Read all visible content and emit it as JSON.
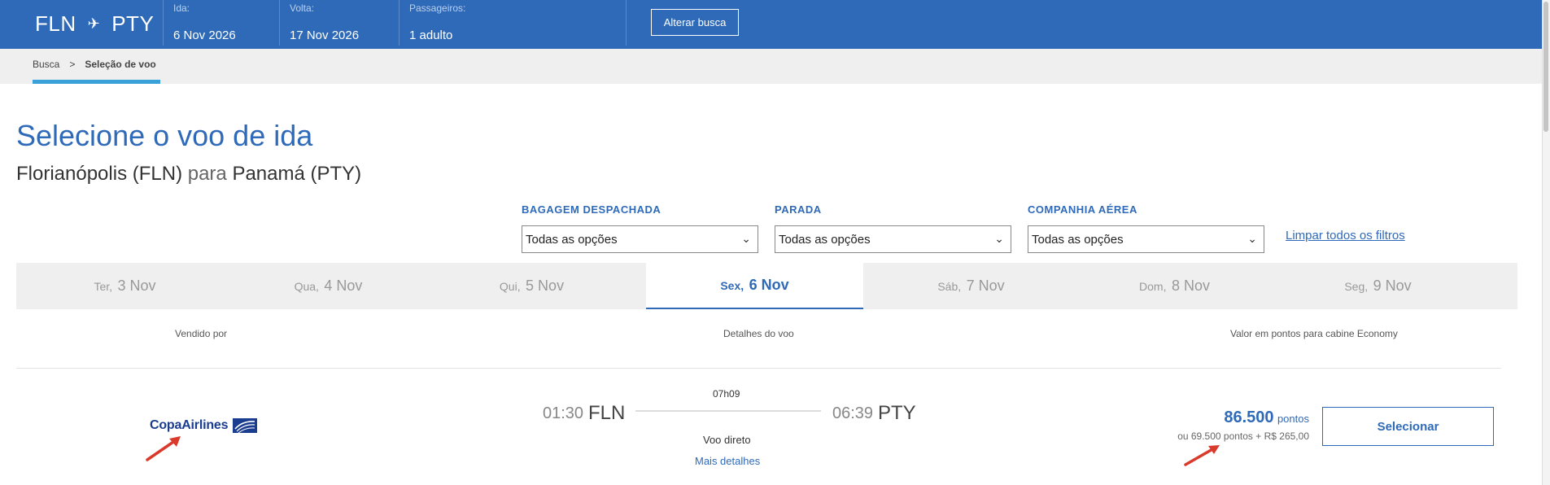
{
  "topbar": {
    "origin": "FLN",
    "destination": "PTY",
    "fields": [
      {
        "label": "Ida:",
        "value": "6 Nov 2026"
      },
      {
        "label": "Volta:",
        "value": "17 Nov 2026"
      },
      {
        "label": "Passageiros:",
        "value": "1 adulto"
      }
    ],
    "alter_button": "Alterar busca"
  },
  "breadcrumb": {
    "items": [
      "Busca",
      ">",
      "Seleção de voo"
    ]
  },
  "page": {
    "title": "Selecione o voo de ida",
    "subtitle_origin": "Florianópolis (FLN)",
    "subtitle_para": "para",
    "subtitle_destination": "Panamá (PTY)"
  },
  "filters": [
    {
      "label": "BAGAGEM DESPACHADA",
      "value": "Todas as opções"
    },
    {
      "label": "PARADA",
      "value": "Todas as opções"
    },
    {
      "label": "COMPANHIA AÉREA",
      "value": "Todas as opções"
    }
  ],
  "clear_filters": "Limpar todos os filtros",
  "date_tabs": [
    {
      "weekday": "Ter,",
      "date": "3 Nov",
      "active": false
    },
    {
      "weekday": "Qua,",
      "date": "4 Nov",
      "active": false
    },
    {
      "weekday": "Qui,",
      "date": "5 Nov",
      "active": false
    },
    {
      "weekday": "Sex,",
      "date": "6 Nov",
      "active": true
    },
    {
      "weekday": "Sáb,",
      "date": "7 Nov",
      "active": false
    },
    {
      "weekday": "Dom,",
      "date": "8 Nov",
      "active": false
    },
    {
      "weekday": "Seg,",
      "date": "9 Nov",
      "active": false
    }
  ],
  "columns": {
    "sold_by": "Vendido por",
    "details": "Detalhes do voo",
    "value": "Valor em pontos para cabine Economy"
  },
  "flight": {
    "airline": "CopaAirlines",
    "duration": "07h09",
    "dep_time": "01:30",
    "dep_code": "FLN",
    "arr_time": "06:39",
    "arr_code": "PTY",
    "stops": "Voo direto",
    "more_details": "Mais detalhes",
    "points": "86.500",
    "points_unit": "pontos",
    "alt_price": "ou 69.500 pontos + R$ 265,00",
    "select_button": "Selecionar"
  },
  "colors": {
    "brand_blue": "#2f6ab8",
    "annotation_red": "#d93a2b",
    "tab_underline": "#3aa0d8"
  }
}
